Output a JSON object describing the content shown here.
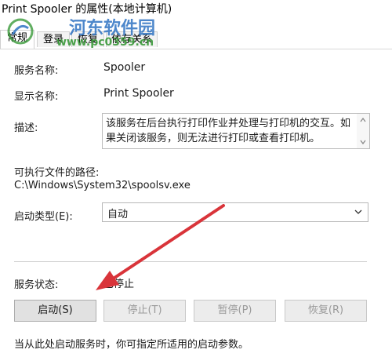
{
  "window": {
    "title": "Print Spooler 的属性(本地计算机)"
  },
  "tabs": [
    {
      "label": "常规",
      "active": true
    },
    {
      "label": "登录",
      "active": false
    },
    {
      "label": "恢复",
      "active": false
    },
    {
      "label": "依存关系",
      "active": false
    }
  ],
  "watermark": {
    "title": "河东软件园",
    "url": "www.pc0359.cn"
  },
  "general": {
    "service_name_label": "服务名称:",
    "service_name": "Spooler",
    "display_name_label": "显示名称:",
    "display_name": "Print Spooler",
    "description_label": "描述:",
    "description": "该服务在后台执行打印作业并处理与打印机的交互。如果关闭该服务，则无法进行打印或查看打印机。",
    "exe_path_label": "可执行文件的路径:",
    "exe_path": "C:\\Windows\\System32\\spoolsv.exe",
    "startup_type_label": "启动类型(E):",
    "startup_type": "自动",
    "status_label": "服务状态:",
    "status": "已停止",
    "buttons": {
      "start": "启动(S)",
      "stop": "停止(T)",
      "pause": "暂停(P)",
      "resume": "恢复(R)"
    },
    "hint": "当从此处启动服务时，你可指定所适用的启动参数。"
  },
  "colors": {
    "accent_arrow": "#d9343a",
    "watermark_blue": "#2f73c2",
    "watermark_green": "#3a9a3a"
  },
  "icons": {
    "scroll_up": "chevron-up-icon",
    "scroll_down": "chevron-down-icon",
    "dropdown": "chevron-down-icon",
    "watermark_logo": "watermark-logo-icon",
    "annotation": "red-arrow-annotation"
  }
}
